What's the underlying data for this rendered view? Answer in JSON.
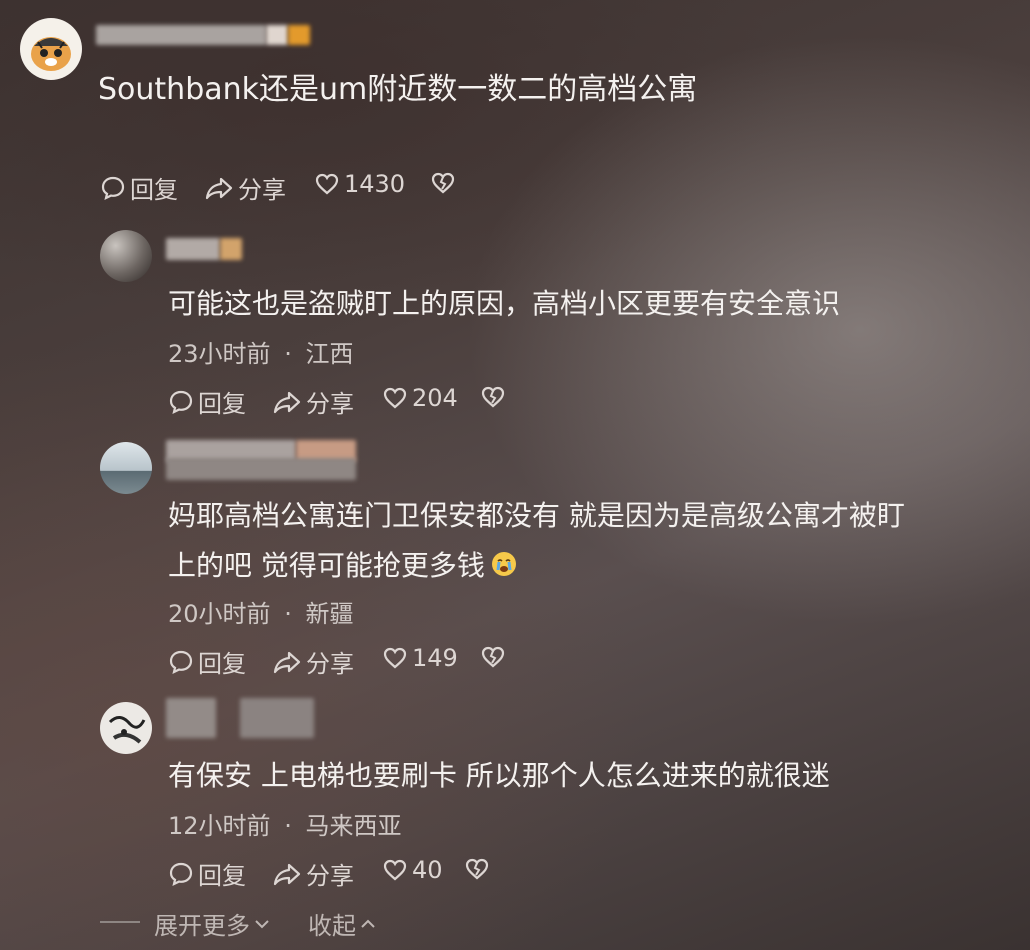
{
  "comments": [
    {
      "text": "Southbank还是um附近数一数二的高档公寓",
      "actions": {
        "reply": "回复",
        "share": "分享",
        "likes": "1430"
      }
    },
    {
      "text": "可能这也是盗贼盯上的原因，高档小区更要有安全意识",
      "time": "23小时前",
      "location": "江西",
      "actions": {
        "reply": "回复",
        "share": "分享",
        "likes": "204"
      }
    },
    {
      "line1": "妈耶高档公寓连门卫保安都没有 就是因为是高级公寓才被盯",
      "line2": "上的吧 觉得可能抢更多钱",
      "time": "20小时前",
      "location": "新疆",
      "actions": {
        "reply": "回复",
        "share": "分享",
        "likes": "149"
      }
    },
    {
      "text": "有保安 上电梯也要刷卡 所以那个人怎么进来的就很迷",
      "time": "12小时前",
      "location": "马来西亚",
      "actions": {
        "reply": "回复",
        "share": "分享",
        "likes": "40"
      }
    }
  ],
  "footer": {
    "expand": "展开更多",
    "collapse": "收起"
  },
  "separator": "·",
  "icons": {
    "reply": "comment-bubble-icon",
    "share": "share-arrow-icon",
    "like": "heart-icon",
    "dislike": "broken-heart-icon",
    "emoji": "crying-face-emoji"
  }
}
